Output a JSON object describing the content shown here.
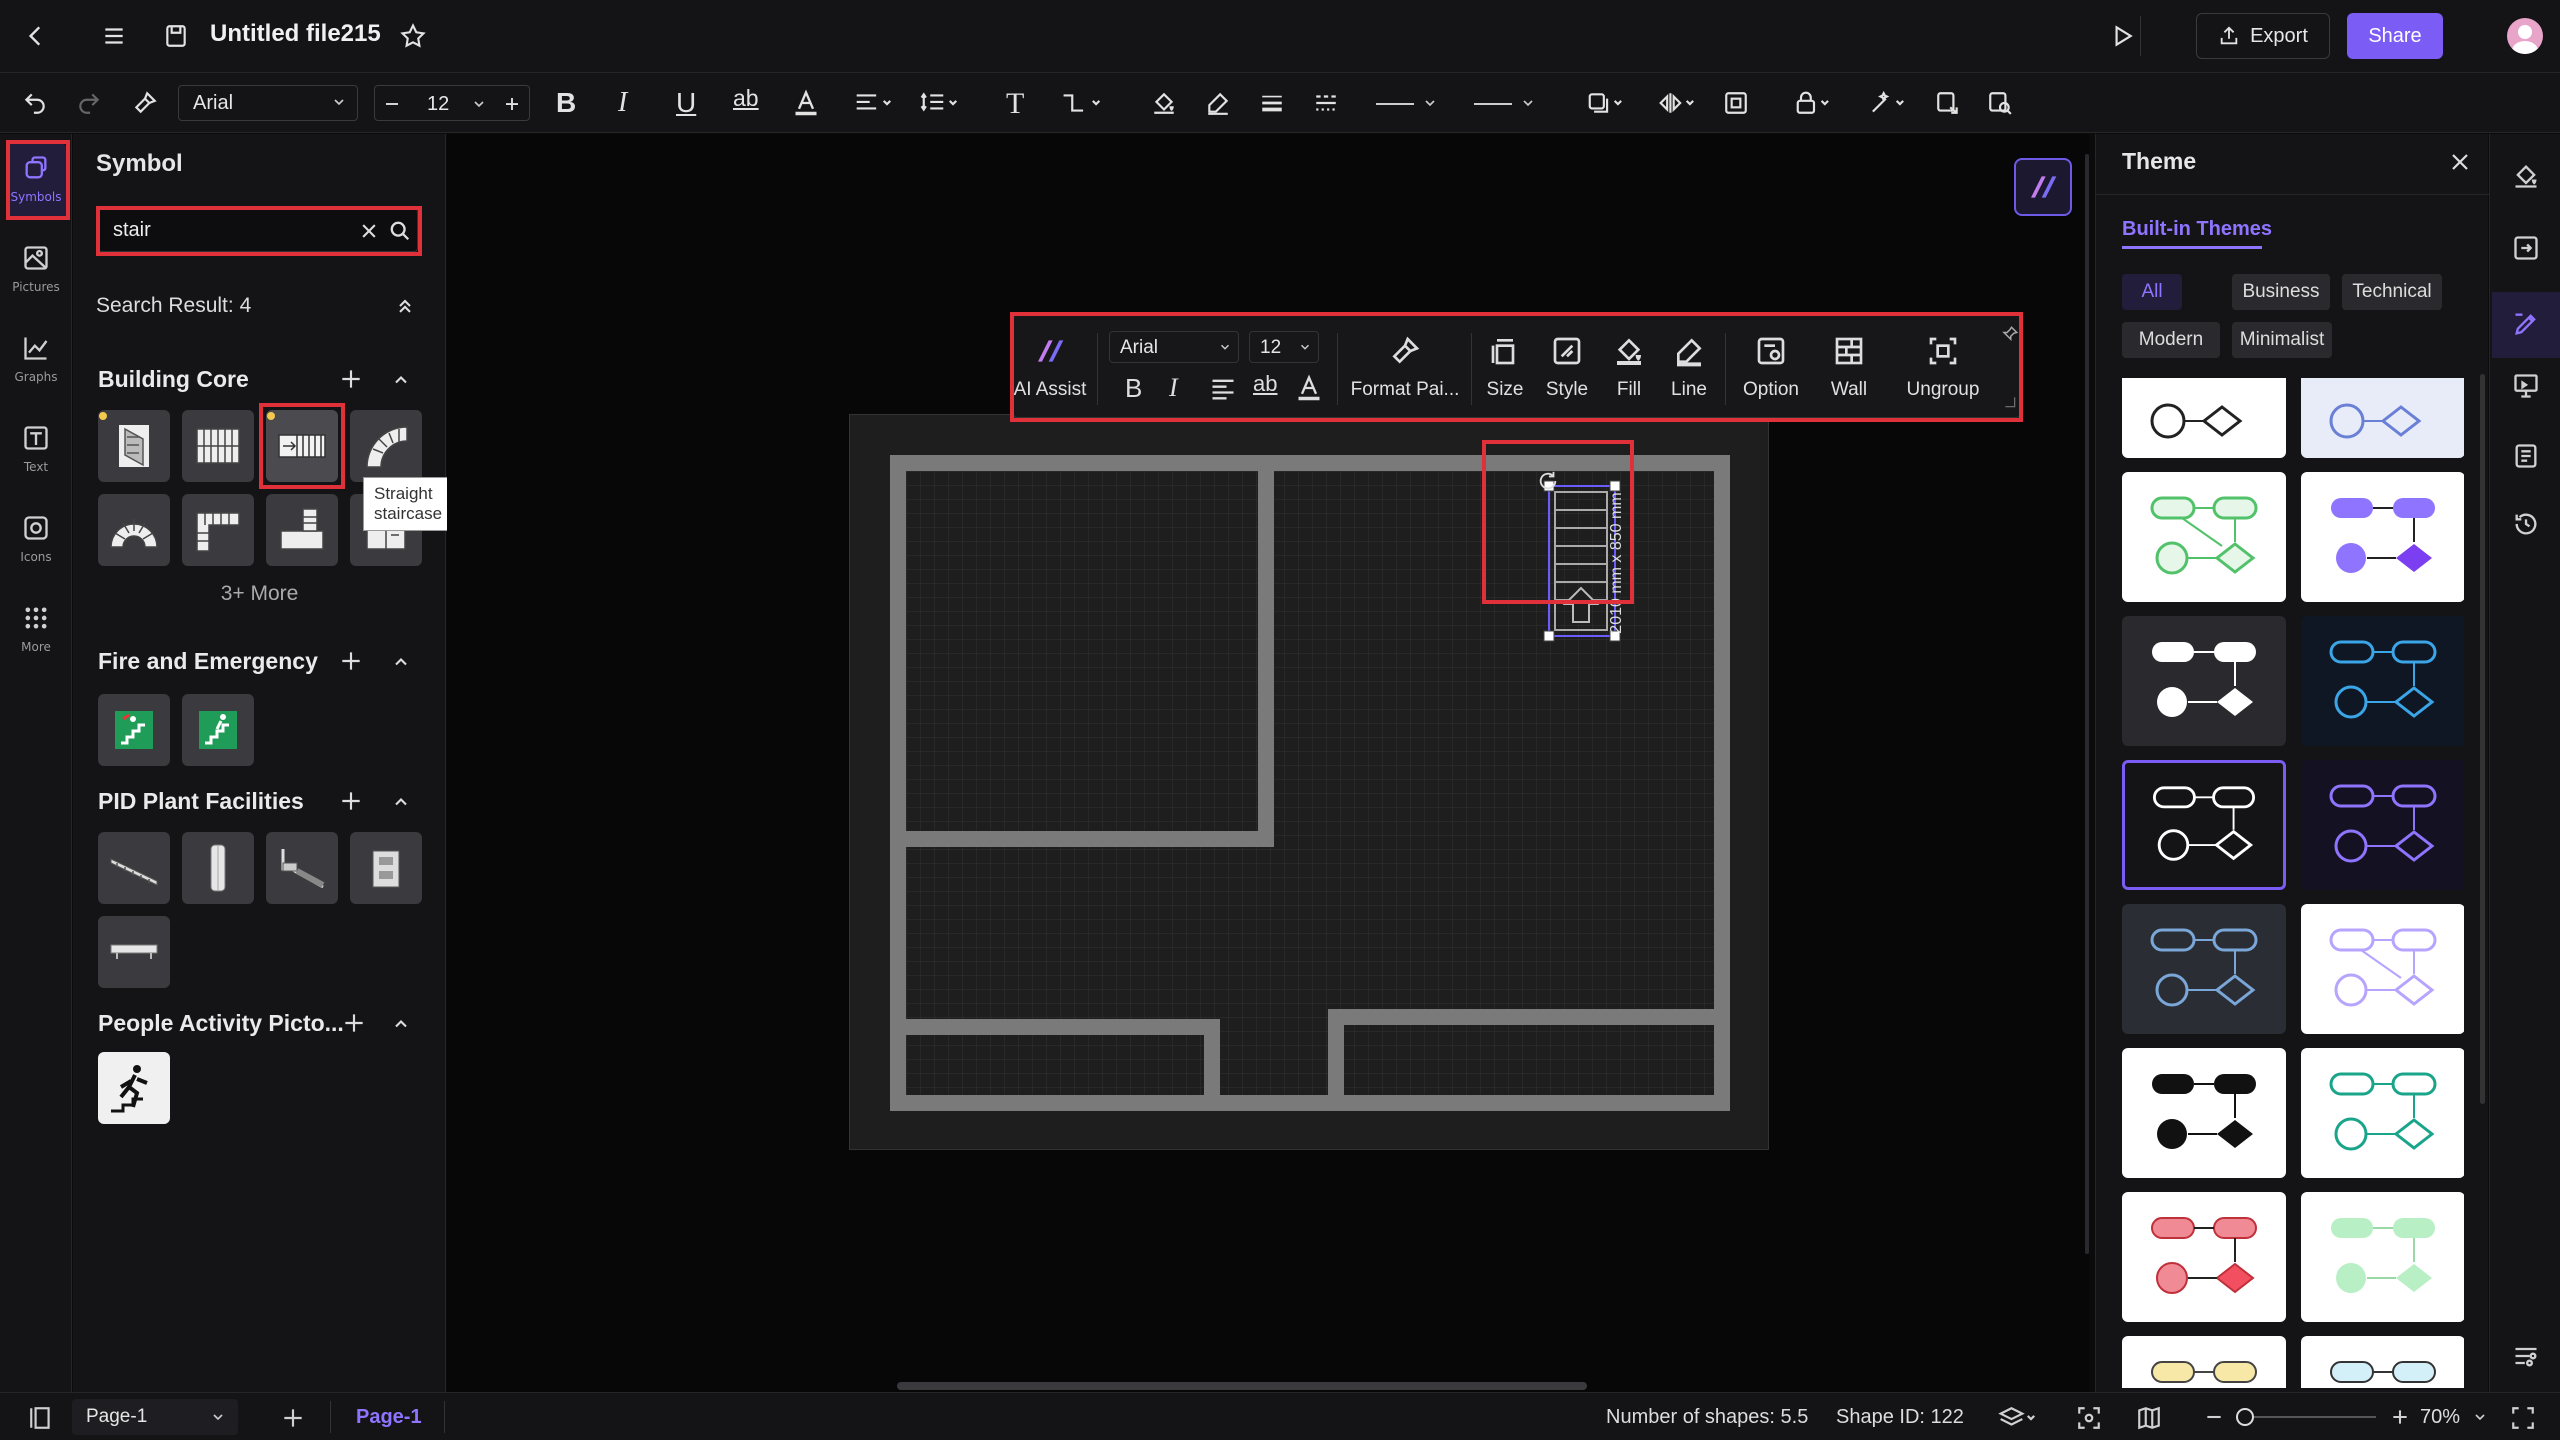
{
  "topbar": {
    "file_title": "Untitled file215",
    "export_label": "Export",
    "share_label": "Share"
  },
  "toolbar": {
    "font_family": "Arial",
    "font_size": "12"
  },
  "left_rail": {
    "items": [
      {
        "label": "Symbols",
        "icon": "symbols-icon"
      },
      {
        "label": "Pictures",
        "icon": "pictures-icon"
      },
      {
        "label": "Graphs",
        "icon": "graphs-icon"
      },
      {
        "label": "Text",
        "icon": "text-icon"
      },
      {
        "label": "Icons",
        "icon": "icons-icon"
      },
      {
        "label": "More",
        "icon": "more-icon"
      }
    ]
  },
  "symbol_panel": {
    "title": "Symbol",
    "search_value": "stair",
    "result_text": "Search Result: 4",
    "sections": [
      {
        "title": "Building Core",
        "more": "3+ More"
      },
      {
        "title": "Fire and Emergency"
      },
      {
        "title": "PID Plant Facilities"
      },
      {
        "title": "People Activity Picto..."
      }
    ],
    "tooltip": "Straight staircase"
  },
  "float_toolbar": {
    "ai_assist": "AI Assist",
    "font_family": "Arial",
    "font_size": "12",
    "format_painter": "Format Pai...",
    "size": "Size",
    "style": "Style",
    "fill": "Fill",
    "line": "Line",
    "option": "Option",
    "wall": "Wall",
    "ungroup": "Ungroup"
  },
  "canvas": {
    "dimension_label": "2010 mm x 850 mm"
  },
  "theme_panel": {
    "title": "Theme",
    "tab_label": "Built-in Themes",
    "filters": [
      "All",
      "Business",
      "Technical",
      "Modern",
      "Minimalist"
    ]
  },
  "statusbar": {
    "page_select": "Page-1",
    "page_tab": "Page-1",
    "shape_count": "Number of shapes: 5.5",
    "shape_id": "Shape ID: 122",
    "zoom": "70%"
  },
  "colors": {
    "accent": "#7b5cf5",
    "highlight": "#e0303a",
    "panel": "#141416"
  }
}
